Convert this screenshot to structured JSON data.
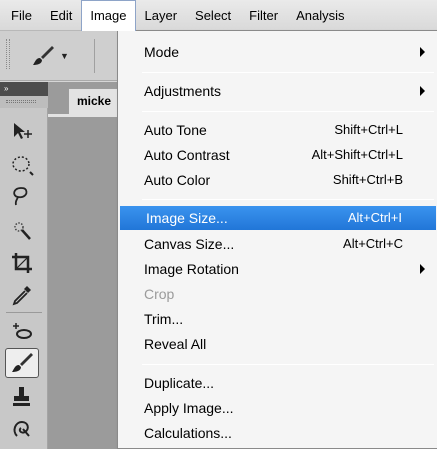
{
  "menubar": {
    "items": [
      {
        "label": "File"
      },
      {
        "label": "Edit"
      },
      {
        "label": "Image"
      },
      {
        "label": "Layer"
      },
      {
        "label": "Select"
      },
      {
        "label": "Filter"
      },
      {
        "label": "Analysis"
      }
    ],
    "active_index": 2
  },
  "options_bar": {
    "brush_preset_icon": "brush-icon",
    "dropdown_icon": "chevron-down-icon"
  },
  "tools_panel": {
    "collapse_label": "»",
    "tools": [
      {
        "icon": "move-icon"
      },
      {
        "icon": "marquee-icon"
      },
      {
        "icon": "lasso-icon"
      },
      {
        "icon": "quick-selection-icon"
      },
      {
        "icon": "crop-icon"
      },
      {
        "icon": "eyedropper-icon"
      },
      {
        "icon": "spot-healing-icon"
      },
      {
        "icon": "brush-icon",
        "selected": true
      },
      {
        "icon": "clone-stamp-icon"
      },
      {
        "icon": "history-brush-icon"
      }
    ]
  },
  "document": {
    "tab_label": "micke"
  },
  "image_menu": {
    "items": [
      {
        "label": "Mode",
        "shortcut": "",
        "submenu": true
      },
      {
        "label": "Adjustments",
        "shortcut": "",
        "submenu": true
      },
      {
        "label": "Auto Tone",
        "shortcut": "Shift+Ctrl+L"
      },
      {
        "label": "Auto Contrast",
        "shortcut": "Alt+Shift+Ctrl+L"
      },
      {
        "label": "Auto Color",
        "shortcut": "Shift+Ctrl+B"
      },
      {
        "label": "Image Size...",
        "shortcut": "Alt+Ctrl+I",
        "highlighted": true
      },
      {
        "label": "Canvas Size...",
        "shortcut": "Alt+Ctrl+C"
      },
      {
        "label": "Image Rotation",
        "shortcut": "",
        "submenu": true
      },
      {
        "label": "Crop",
        "shortcut": "",
        "disabled": true
      },
      {
        "label": "Trim...",
        "shortcut": ""
      },
      {
        "label": "Reveal All",
        "shortcut": ""
      },
      {
        "label": "Duplicate...",
        "shortcut": ""
      },
      {
        "label": "Apply Image...",
        "shortcut": ""
      },
      {
        "label": "Calculations...",
        "shortcut": ""
      }
    ]
  },
  "colors": {
    "highlight": "#2c86e4",
    "menu_bg": "#f5f5f5",
    "disabled_text": "#9b9b9b"
  }
}
